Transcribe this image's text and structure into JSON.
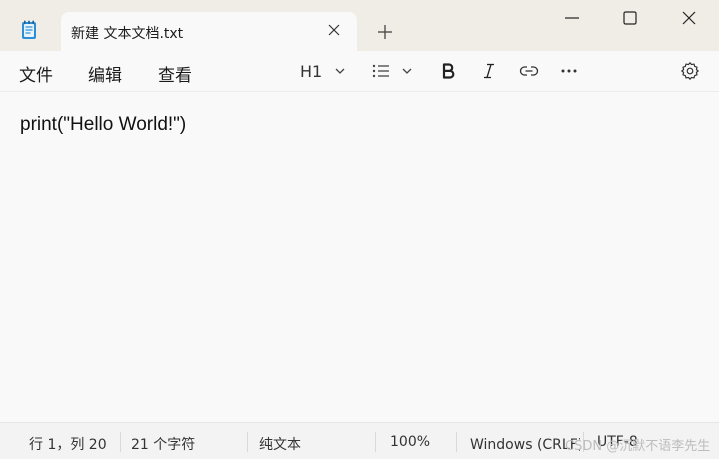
{
  "window": {
    "tab_title": "新建 文本文档.txt",
    "icons": {
      "app": "notepad-icon",
      "tab_close": "close-icon",
      "new_tab": "plus-icon",
      "minimize": "minimize-icon",
      "maximize": "maximize-icon",
      "close": "close-icon"
    }
  },
  "menu": {
    "file": "文件",
    "edit": "编辑",
    "view": "查看"
  },
  "toolbar": {
    "heading": "H1",
    "icons": [
      "chevron-down-icon",
      "list-icon",
      "bold-icon",
      "italic-icon",
      "link-icon",
      "more-icon",
      "settings-icon"
    ]
  },
  "editor": {
    "content": "print(\"Hello World!\")"
  },
  "status": {
    "position": "行 1，列 20",
    "chars": "21 个字符",
    "format": "纯文本",
    "zoom": "100%",
    "line_ending": "Windows (CRLF)",
    "encoding": "UTF-8",
    "watermark": "CSDN @沉默不语李先生"
  }
}
